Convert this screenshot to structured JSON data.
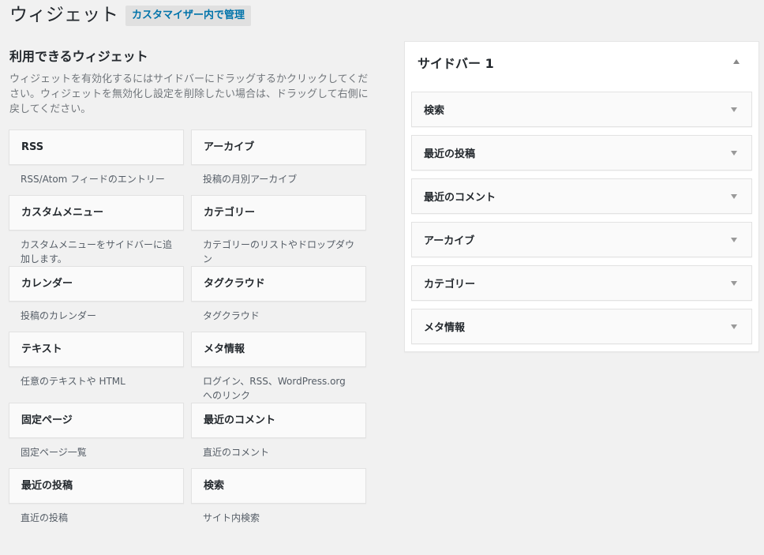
{
  "page": {
    "title": "ウィジェット",
    "customizer_button": "カスタマイザー内で管理"
  },
  "available": {
    "title": "利用できるウィジェット",
    "description": "ウィジェットを有効化するにはサイドバーにドラッグするかクリックしてください。ウィジェットを無効化し設定を削除したい場合は、ドラッグして右側に戻してください。",
    "widgets": [
      {
        "title": "RSS",
        "description": "RSS/Atom フィードのエントリー"
      },
      {
        "title": "アーカイブ",
        "description": "投稿の月別アーカイブ"
      },
      {
        "title": "カスタムメニュー",
        "description": "カスタムメニューをサイドバーに追加します。"
      },
      {
        "title": "カテゴリー",
        "description": "カテゴリーのリストやドロップダウン"
      },
      {
        "title": "カレンダー",
        "description": "投稿のカレンダー"
      },
      {
        "title": "タグクラウド",
        "description": "タグクラウド"
      },
      {
        "title": "テキスト",
        "description": "任意のテキストや HTML"
      },
      {
        "title": "メタ情報",
        "description": "ログイン、RSS、WordPress.org へのリンク"
      },
      {
        "title": "固定ページ",
        "description": "固定ページ一覧"
      },
      {
        "title": "最近のコメント",
        "description": "直近のコメント"
      },
      {
        "title": "最近の投稿",
        "description": "直近の投稿"
      },
      {
        "title": "検索",
        "description": "サイト内検索"
      }
    ]
  },
  "sidebar": {
    "title": "サイドバー 1",
    "widgets": [
      "検索",
      "最近の投稿",
      "最近のコメント",
      "アーカイブ",
      "カテゴリー",
      "メタ情報"
    ]
  }
}
